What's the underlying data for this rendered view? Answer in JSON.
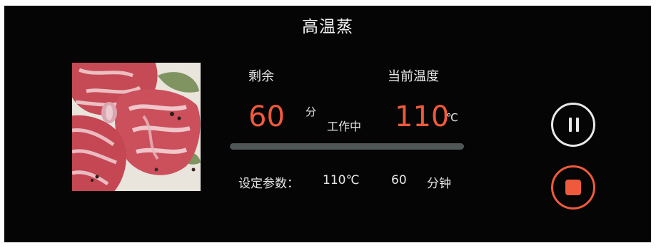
{
  "header": {
    "title": "高温蒸"
  },
  "timer": {
    "label": "剩余",
    "value": "60",
    "unit": "分"
  },
  "status": {
    "text": "工作中"
  },
  "temperature": {
    "label": "当前温度",
    "value": "110",
    "unit": "℃"
  },
  "progress": {
    "fraction": 0.0
  },
  "settings": {
    "label": "设定参数：",
    "temperature": "110℃",
    "duration_value": "60",
    "duration_unit": "分钟"
  },
  "controls": {
    "pause_icon": "pause-icon",
    "stop_icon": "stop-icon"
  },
  "colors": {
    "accent": "#ef5a3c",
    "background": "#050505",
    "text": "#e6e6e6",
    "track": "#4f5656"
  }
}
